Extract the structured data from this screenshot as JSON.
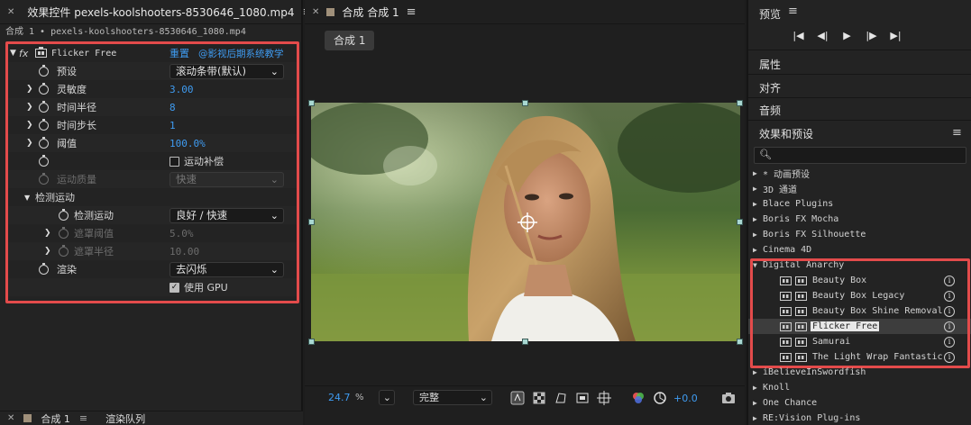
{
  "effect_controls": {
    "tab_title": "效果控件 pexels-koolshooters-8530646_1080.mp4",
    "comp_path": "合成 1 • pexels-koolshooters-8530646_1080.mp4",
    "effect_name": "Flicker Free",
    "fx_label": "fx",
    "reset_label": "重置",
    "credit": "@影视后期系统教学",
    "props": {
      "preset": {
        "label": "预设",
        "value": "滚动条带(默认)"
      },
      "sensitivity": {
        "label": "灵敏度",
        "value": "3.00"
      },
      "time_radius": {
        "label": "时间半径",
        "value": "8"
      },
      "time_step": {
        "label": "时间步长",
        "value": "1"
      },
      "threshold": {
        "label": "阈值",
        "value": "100.0%"
      },
      "motion_comp": {
        "label": "运动补偿",
        "checked": false
      },
      "motion_quality": {
        "label": "运动质量",
        "value": "快速"
      },
      "detect_group": {
        "label": "检测运动"
      },
      "detect_motion": {
        "label": "检测运动",
        "value": "良好 / 快速"
      },
      "mask_threshold": {
        "label": "遮罩阈值",
        "value": "5.0%"
      },
      "mask_radius": {
        "label": "遮罩半径",
        "value": "10.00"
      },
      "render": {
        "label": "渲染",
        "value": "去闪烁"
      },
      "use_gpu": {
        "label": "使用 GPU",
        "checked": true
      }
    }
  },
  "bottom_tabs": {
    "comp": "合成 1",
    "render_queue": "渲染队列"
  },
  "composition": {
    "tab_title": "合成 合成 1",
    "comp_button": "合成 1",
    "zoom": "24.7",
    "zoom_unit": "%",
    "resolution": "完整",
    "exposure": "+0.0"
  },
  "right_panel": {
    "preview_title": "预览",
    "properties": "属性",
    "align": "对齐",
    "audio": "音频",
    "effects_presets": "效果和预设",
    "categories": [
      "* 动画预设",
      "3D 通道",
      "Blace Plugins",
      "Boris FX Mocha",
      "Boris FX Silhouette",
      "Cinema 4D",
      "Digital Anarchy"
    ],
    "da_items": [
      "Beauty Box",
      "Beauty Box Legacy",
      "Beauty Box Shine Removal",
      "Flicker Free",
      "Samurai",
      "The Light Wrap Fantastic"
    ],
    "more_categories": [
      "iBelieveInSwordfish",
      "Knoll",
      "One Chance",
      "RE:Vision Plug-ins"
    ]
  },
  "colors": {
    "accent": "#3f9cf2",
    "highlight_border": "#e34b4b",
    "handle": "#a9d8d2"
  }
}
